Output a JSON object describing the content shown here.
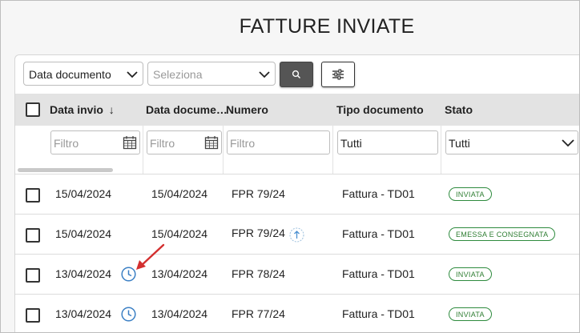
{
  "page": {
    "title": "FATTURE INVIATE"
  },
  "filters": {
    "date_type_value": "Data documento",
    "period_placeholder": "Seleziona"
  },
  "table": {
    "columns": [
      "Data invio",
      "Data documento",
      "Numero",
      "Tipo documento",
      "Stato"
    ],
    "column_data_documento_display": "Data docume…",
    "sort_indicator": "↓",
    "filter_row": {
      "data_invio_placeholder": "Filtro",
      "data_documento_placeholder": "Filtro",
      "numero_placeholder": "Filtro",
      "tipo_documento_value": "Tutti",
      "stato_value": "Tutti"
    },
    "rows": [
      {
        "data_invio": "15/04/2024",
        "data_documento": "15/04/2024",
        "numero": "FPR 79/24",
        "tipo": "Fattura - TD01",
        "stato": "INVIATA",
        "clock": false,
        "upload": false
      },
      {
        "data_invio": "15/04/2024",
        "data_documento": "15/04/2024",
        "numero": "FPR 79/24",
        "tipo": "Fattura - TD01",
        "stato": "EMESSA E CONSEGNATA",
        "clock": false,
        "upload": true
      },
      {
        "data_invio": "13/04/2024",
        "data_documento": "13/04/2024",
        "numero": "FPR 78/24",
        "tipo": "Fattura - TD01",
        "stato": "INVIATA",
        "clock": true,
        "upload": false
      },
      {
        "data_invio": "13/04/2024",
        "data_documento": "13/04/2024",
        "numero": "FPR 77/24",
        "tipo": "Fattura - TD01",
        "stato": "INVIATA",
        "clock": true,
        "upload": false
      }
    ]
  },
  "icons": {
    "search": "search-icon",
    "filters": "sliders-icon",
    "calendar": "calendar-icon",
    "clock": "clock-icon",
    "upload": "upload-icon",
    "annotation": "red-arrow-icon"
  },
  "colors": {
    "status_green": "#2e7d32",
    "clock_blue": "#3a7fc4",
    "annotation_red": "#d32f2f",
    "header_bg": "#e3e3e3",
    "search_button": "#555555"
  }
}
